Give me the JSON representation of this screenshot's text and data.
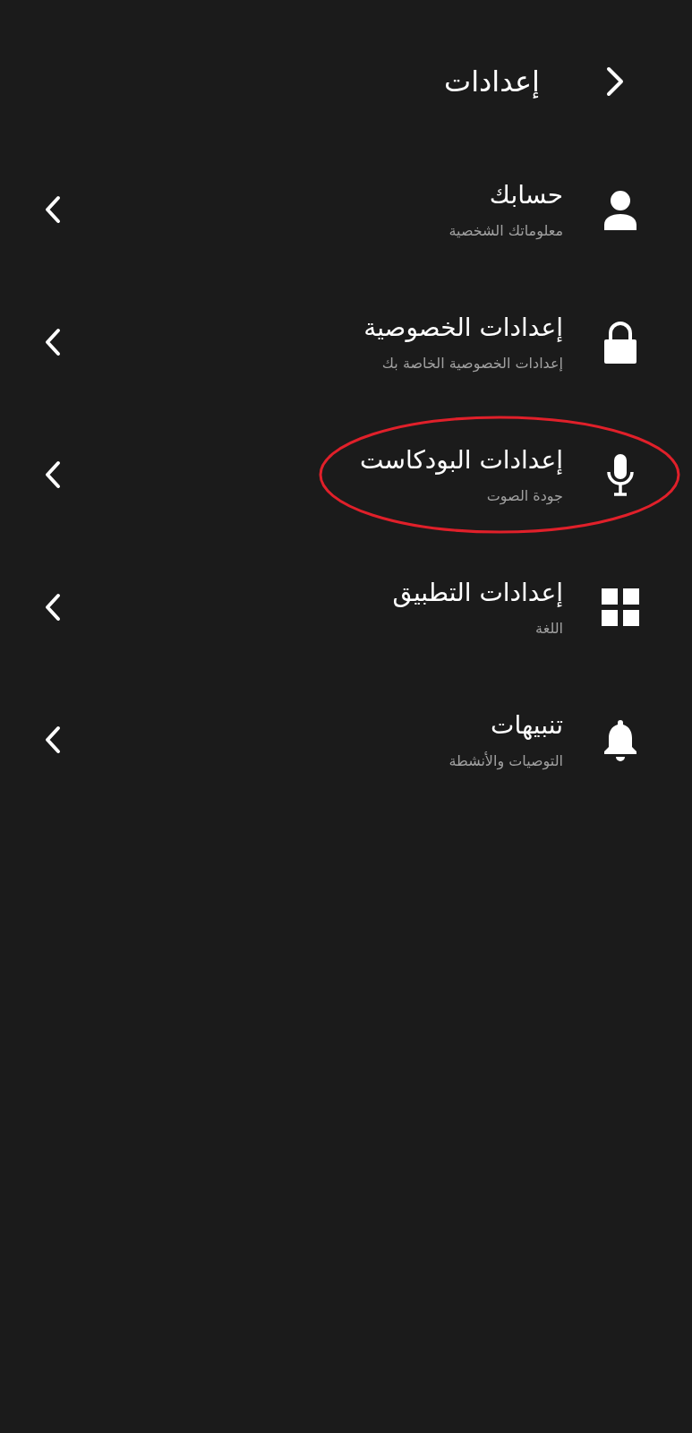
{
  "header": {
    "title": "إعدادات"
  },
  "items": [
    {
      "title": "حسابك",
      "subtitle": "معلوماتك الشخصية",
      "highlighted": false
    },
    {
      "title": "إعدادات الخصوصية",
      "subtitle": "إعدادات الخصوصية الخاصة بك",
      "highlighted": false
    },
    {
      "title": "إعدادات البودكاست",
      "subtitle": "جودة الصوت",
      "highlighted": true
    },
    {
      "title": "إعدادات التطبيق",
      "subtitle": "اللغة",
      "highlighted": false
    },
    {
      "title": "تنبيهات",
      "subtitle": "التوصيات والأنشطة",
      "highlighted": false
    }
  ]
}
